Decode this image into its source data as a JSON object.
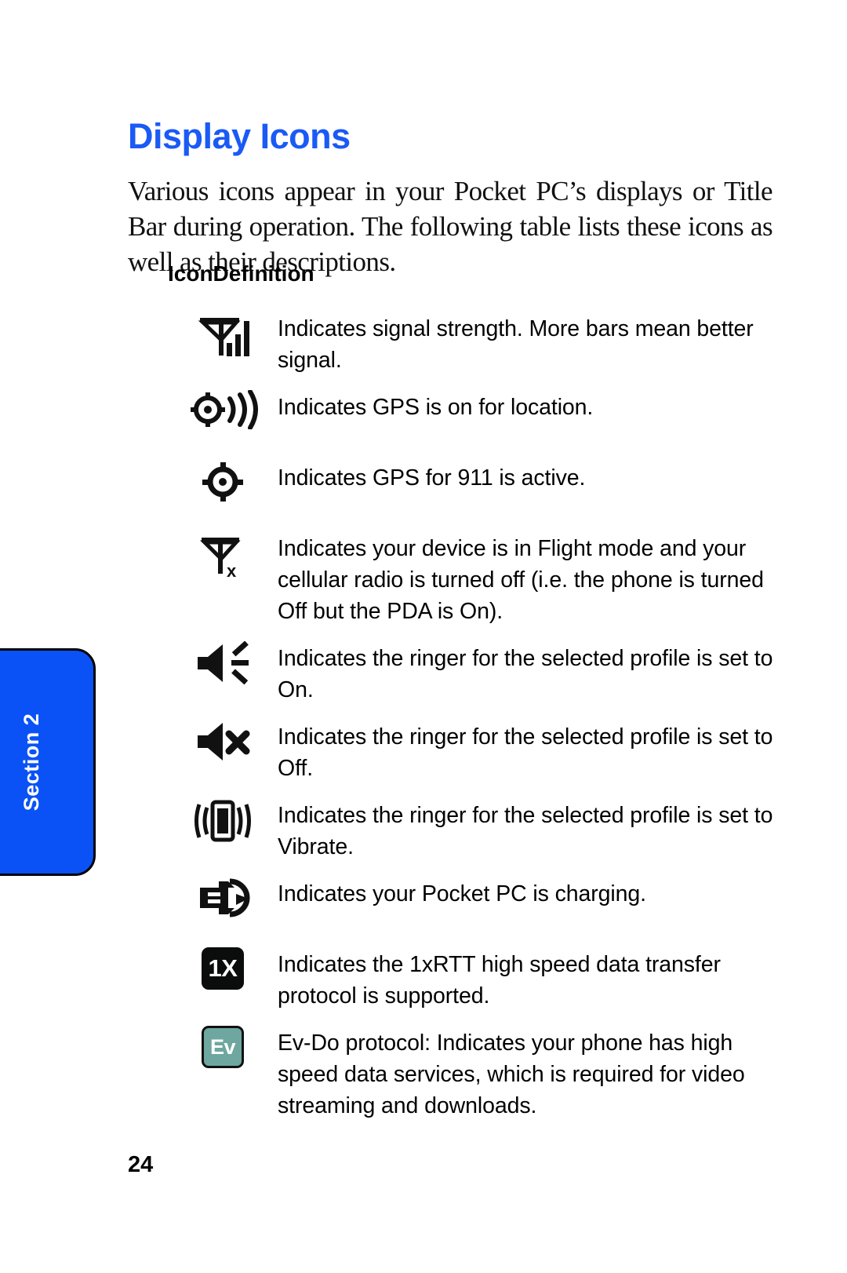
{
  "section_tab": {
    "label": "Section 2",
    "color": "#0a52f5"
  },
  "page": {
    "title": "Display Icons",
    "title_color": "#1a5af5",
    "intro": "Various icons appear in your Pocket PC’s displays or Title Bar during operation. The following table lists these icons as well as their descriptions.",
    "page_number": "24"
  },
  "table": {
    "header": "IconDefinition",
    "column_icon": "Icon",
    "column_definition": "Definition",
    "rows": [
      {
        "icon": "signal-strength-icon",
        "definition": "Indicates signal strength. More bars mean better signal."
      },
      {
        "icon": "gps-on-icon",
        "definition": "Indicates GPS is on for location."
      },
      {
        "icon": "gps-911-icon",
        "definition": "Indicates GPS for 911 is active."
      },
      {
        "icon": "flight-mode-icon",
        "definition": "Indicates your device is in Flight mode and your cellular radio is turned off (i.e. the phone is turned Off but the PDA is On)."
      },
      {
        "icon": "ringer-on-icon",
        "definition": "Indicates the ringer for the selected profile is set to On."
      },
      {
        "icon": "ringer-off-icon",
        "definition": "Indicates the ringer for the selected profile is set to Off."
      },
      {
        "icon": "ringer-vibrate-icon",
        "definition": "Indicates the ringer for the selected profile is set to Vibrate."
      },
      {
        "icon": "battery-charging-icon",
        "definition": "Indicates your Pocket PC is charging."
      },
      {
        "icon": "one-x-badge-icon",
        "badge_label": "1X",
        "badge_color": "#0b0d0c",
        "definition": "Indicates the 1xRTT high speed data transfer protocol is supported."
      },
      {
        "icon": "ev-do-badge-icon",
        "badge_label": "Ev",
        "badge_color": "#6ea7a0",
        "definition": "Ev-Do protocol: Indicates your phone has high speed data services, which is required for video streaming and downloads."
      }
    ]
  }
}
